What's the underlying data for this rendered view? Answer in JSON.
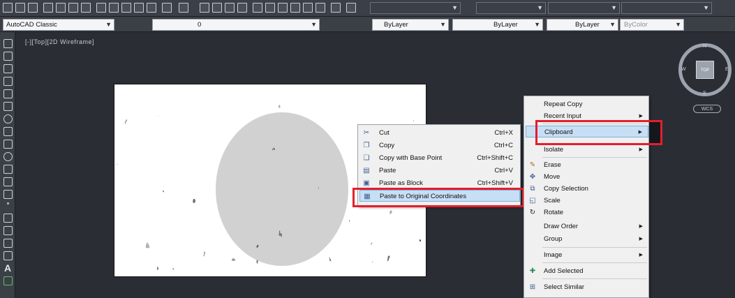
{
  "toolbar": {
    "workspace": "AutoCAD Classic",
    "layer": "0",
    "color": "ByLayer",
    "linetype": "ByLayer",
    "lineweight": "ByLayer",
    "plotstyle": "ByColor"
  },
  "viewport": {
    "label": "[-][Top][2D Wireframe]"
  },
  "viewcube": {
    "face": "TOP",
    "north": "N",
    "south": "S",
    "east": "E",
    "west": "W",
    "wcs": "WCS"
  },
  "clipboard_menu": {
    "items": [
      {
        "label": "Cut",
        "shortcut": "Ctrl+X",
        "icon": "scissors-icon"
      },
      {
        "label": "Copy",
        "shortcut": "Ctrl+C",
        "icon": "copy-icon"
      },
      {
        "label": "Copy with Base Point",
        "shortcut": "Ctrl+Shift+C",
        "icon": "copy-base-icon"
      },
      {
        "label": "Paste",
        "shortcut": "Ctrl+V",
        "icon": "paste-icon"
      },
      {
        "label": "Paste as Block",
        "shortcut": "Ctrl+Shift+V",
        "icon": "paste-block-icon"
      },
      {
        "label": "Paste to Original Coordinates",
        "shortcut": "",
        "icon": "paste-original-icon"
      }
    ]
  },
  "context_menu": {
    "items": [
      {
        "label": "Repeat Copy"
      },
      {
        "label": "Recent Input",
        "submenu": true
      },
      {
        "label": "Clipboard",
        "submenu": true
      },
      {
        "label": "Isolate",
        "submenu": true
      },
      {
        "label": "Erase",
        "icon": "erase-icon"
      },
      {
        "label": "Move",
        "icon": "move-icon"
      },
      {
        "label": "Copy Selection",
        "icon": "copy-selection-icon"
      },
      {
        "label": "Scale",
        "icon": "scale-icon"
      },
      {
        "label": "Rotate",
        "icon": "rotate-icon"
      },
      {
        "label": "Draw Order",
        "submenu": true
      },
      {
        "label": "Group",
        "submenu": true
      },
      {
        "label": "Image",
        "submenu": true
      },
      {
        "label": "Add Selected",
        "icon": "add-selected-icon"
      },
      {
        "label": "Select Similar",
        "icon": "select-similar-icon"
      }
    ]
  },
  "colors": {
    "highlight": "#c7dff5",
    "callout": "#e51e2a",
    "ui_dark": "#3b3f46"
  }
}
